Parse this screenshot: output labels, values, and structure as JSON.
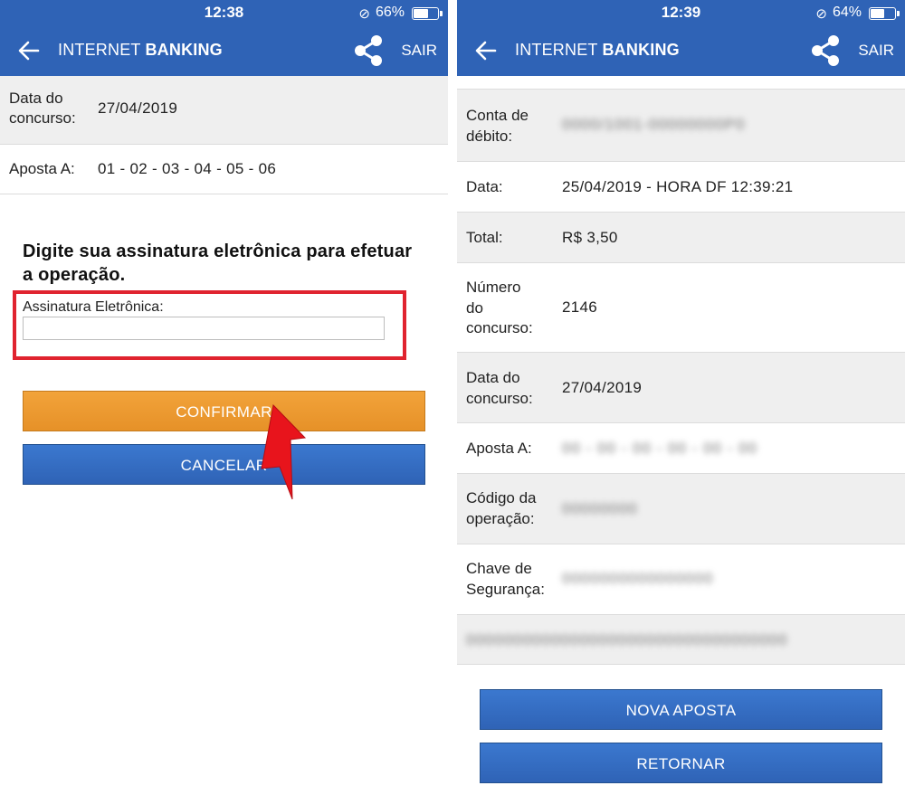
{
  "left": {
    "status": {
      "time": "12:38",
      "battery_pct": "66%",
      "battery_level": 0.66
    },
    "header": {
      "title_light": "INTERNET ",
      "title_bold": "BANKING",
      "exit_label": "SAIR"
    },
    "rows": [
      {
        "label": "Data do concurso:",
        "value": "27/04/2019"
      },
      {
        "label": "Aposta A:",
        "value": "01 - 02 - 03 - 04 - 05 - 06"
      }
    ],
    "prompt": "Digite sua assinatura eletrônica para efetuar a operação.",
    "signature_label": "Assinatura Eletrônica:",
    "signature_value": "",
    "confirm_label": "CONFIRMAR",
    "cancel_label": "CANCELAR"
  },
  "right": {
    "status": {
      "time": "12:39",
      "battery_pct": "64%",
      "battery_level": 0.64
    },
    "header": {
      "title_light": "INTERNET ",
      "title_bold": "BANKING",
      "exit_label": "SAIR"
    },
    "rows": [
      {
        "label": "Conta de débito:",
        "value": "0000/1001-00000000P0"
      },
      {
        "label": "Data:",
        "value": "25/04/2019 - HORA DF 12:39:21"
      },
      {
        "label": "Total:",
        "value": "R$ 3,50"
      },
      {
        "label": "Número do concurso:",
        "value": "2146"
      },
      {
        "label": "Data do concurso:",
        "value": "27/04/2019"
      },
      {
        "label": "Aposta A:",
        "value": "00 - 00 - 00 - 00 - 00 - 00"
      },
      {
        "label": "Código da operação:",
        "value": "00000000"
      },
      {
        "label": "Chave de Segurança:",
        "value": "0000000000000000"
      },
      {
        "label": "",
        "value": "0000000000000000000000000000000000"
      }
    ],
    "new_bet_label": "NOVA APOSTA",
    "return_label": "RETORNAR"
  }
}
